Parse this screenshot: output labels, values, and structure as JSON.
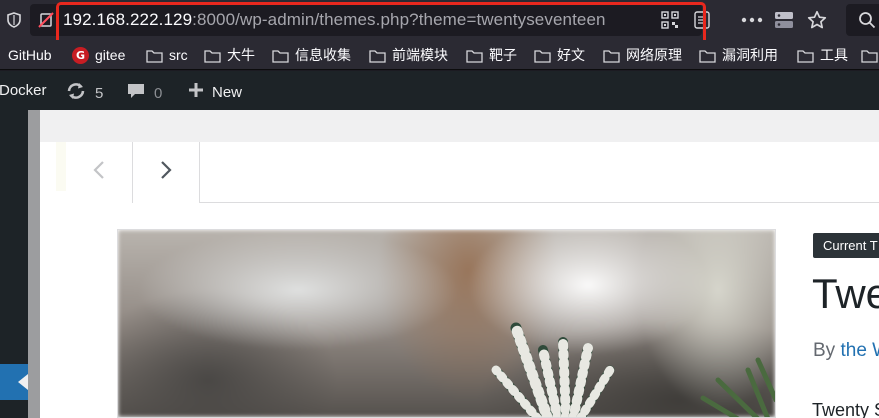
{
  "browser": {
    "url_host": "192.168.222.129",
    "url_rest": ":8000/wp-admin/themes.php?theme=twentyseventeen",
    "icons": [
      "shield-icon",
      "tracking-off-icon",
      "qr-code-icon",
      "reader-view-icon",
      "more-icon",
      "server-icon",
      "bookmark-star-icon",
      "search-icon"
    ]
  },
  "bookmarks": [
    {
      "label": "GitHub",
      "icon": "none"
    },
    {
      "label": "gitee",
      "icon": "gitee-logo"
    },
    {
      "label": "src",
      "icon": "folder"
    },
    {
      "label": "大牛",
      "icon": "folder"
    },
    {
      "label": "信息收集",
      "icon": "folder"
    },
    {
      "label": "前端模块",
      "icon": "folder"
    },
    {
      "label": "靶子",
      "icon": "folder"
    },
    {
      "label": "好文",
      "icon": "folder"
    },
    {
      "label": "网络原理",
      "icon": "folder"
    },
    {
      "label": "漏洞利用",
      "icon": "folder"
    },
    {
      "label": "工具",
      "icon": "folder"
    }
  ],
  "adminbar": {
    "site_label": "Docker",
    "updates_count": "5",
    "comments_count": "0",
    "new_label": "New"
  },
  "theme_modal": {
    "badge": "Current T",
    "name": "Twe",
    "author_prefix": "By",
    "author_link": "the W",
    "description": "Twenty S"
  },
  "colors": {
    "highlight_border": "#e8281e",
    "admin_bar": "#1d2327",
    "link": "#2271b1"
  }
}
